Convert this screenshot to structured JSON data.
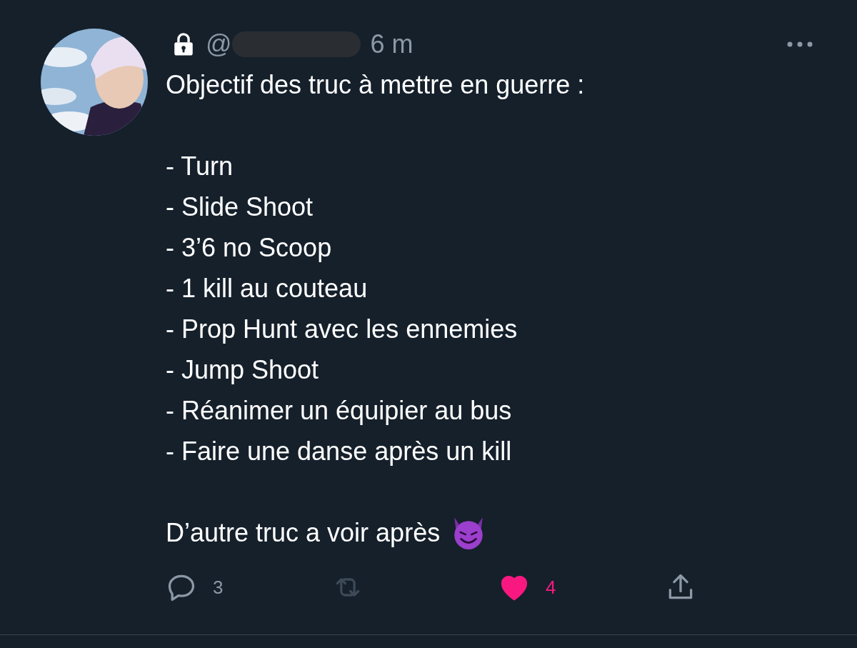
{
  "tweet": {
    "locked": true,
    "handle": "@",
    "handle_redacted": true,
    "time": "6 m",
    "intro": "Objectif des truc à mettre en guerre :",
    "items": [
      "- Turn",
      "- Slide Shoot",
      "- 3’6 no Scoop",
      "- 1 kill au couteau",
      "- Prop Hunt avec les ennemies",
      "- Jump Shoot",
      "- Réanimer un équipier au bus",
      "- Faire une danse après un kill"
    ],
    "closing": "D’autre truc a voir après",
    "actions": [
      {
        "kind": "reply",
        "count": "3"
      },
      {
        "kind": "retweet",
        "disabled": true
      },
      {
        "kind": "like",
        "count": "4",
        "selected": true
      },
      {
        "kind": "share"
      }
    ]
  }
}
